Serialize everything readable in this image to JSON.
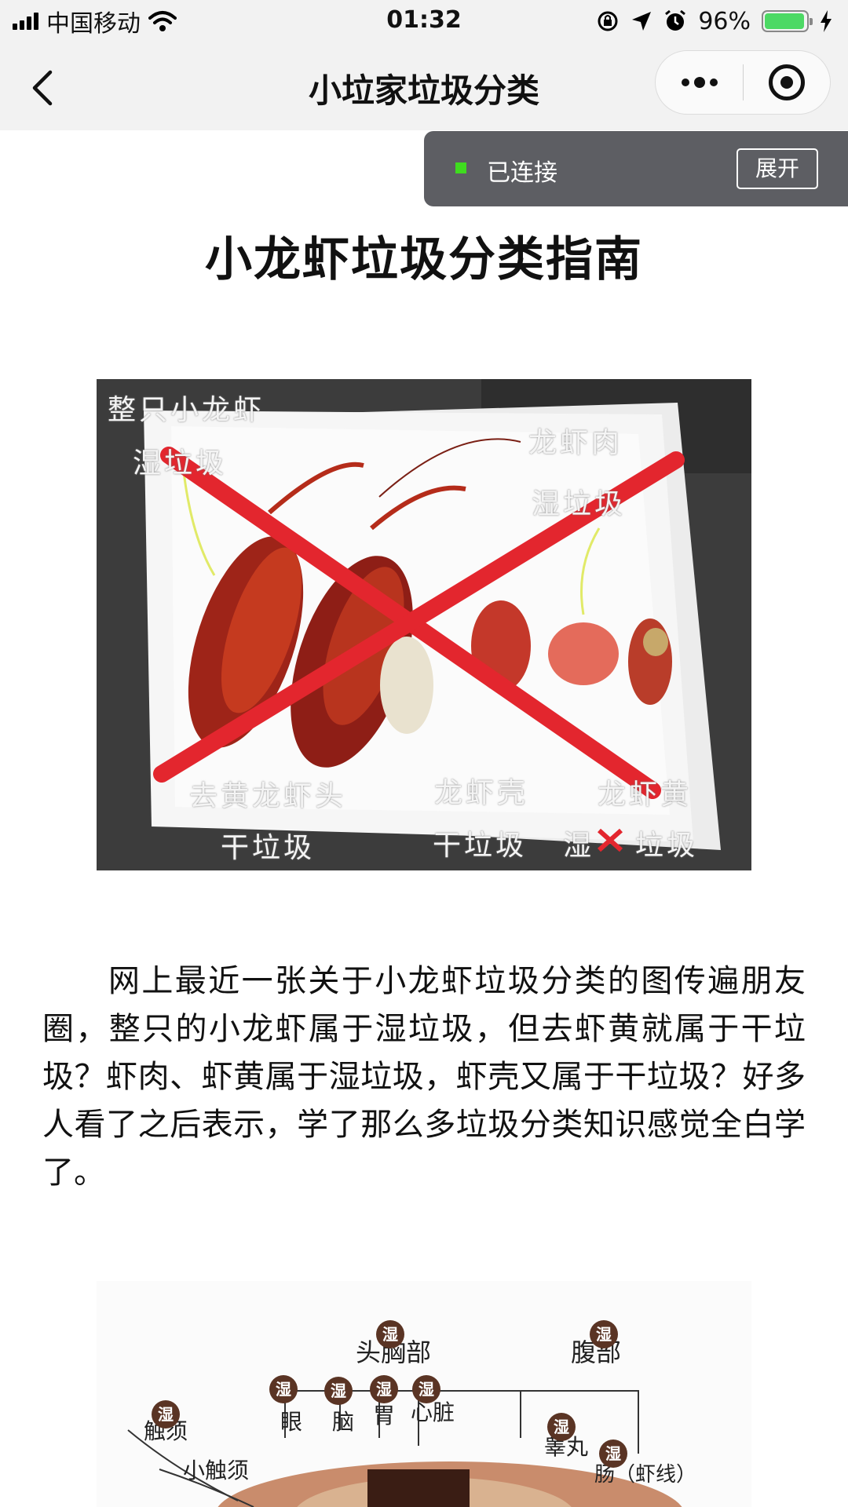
{
  "status_bar": {
    "carrier": "中国移动",
    "time": "01:32",
    "battery": "96%",
    "battery_level": 0.96
  },
  "nav": {
    "title": "小垃家垃圾分类"
  },
  "connection": {
    "status": "已连接",
    "expand_label": "展开",
    "status_color": "#3fdc1f"
  },
  "article": {
    "title": "小龙虾垃圾分类指南",
    "image1_notes": {
      "whole": "整只小龙虾",
      "whole_wet": "湿垃圾",
      "meat": "龙虾肉",
      "meat_wet": "湿垃圾",
      "head": "去黄龙虾头",
      "head_dry": "干垃圾",
      "shell": "龙虾壳",
      "shell_dry": "干垃圾",
      "roe": "龙虾黄",
      "roe_wet_a": "湿",
      "roe_wet_b": "垃圾"
    },
    "paragraph": "网上最近一张关于小龙虾垃圾分类的图传遍朋友圈，整只的小龙虾属于湿垃圾，但去虾黄就属于干垃圾？虾肉、虾黄属于湿垃圾，虾壳又属于干垃圾？好多人看了之后表示，学了那么多垃圾分类知识感觉全白学了。",
    "image2_labels": {
      "head": "头胸部",
      "abdomen": "腹部",
      "antenna": "触须",
      "small_antenna": "小触须",
      "eye": "眼",
      "brain": "脑",
      "stomach": "胃",
      "heart": "心脏",
      "testis": "睾丸",
      "gut": "肠（虾线）",
      "wet_badge": "湿"
    }
  },
  "colors": {
    "bar_bg": "#f2f2f2",
    "banner_bg": "#5d5e63",
    "cross_red": "#e3262e"
  }
}
